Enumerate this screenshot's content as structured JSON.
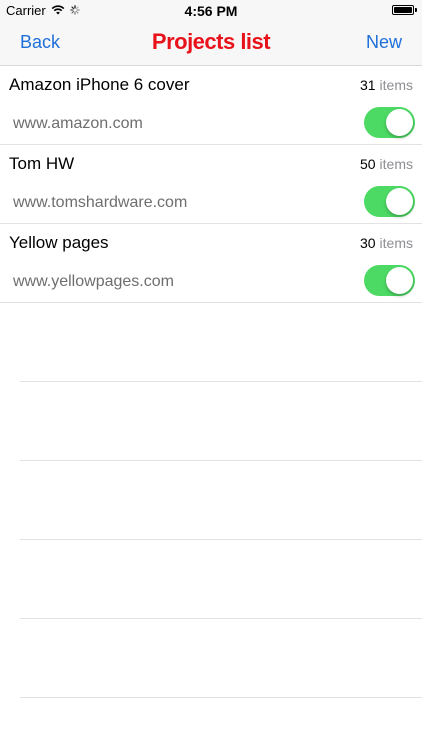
{
  "status_bar": {
    "carrier": "Carrier",
    "time": "4:56 PM"
  },
  "nav": {
    "back_label": "Back",
    "title": "Projects list",
    "new_label": "New",
    "title_color": "#e8121a",
    "accent_color": "#1e6fd9"
  },
  "projects": [
    {
      "name": "Amazon iPhone 6 cover",
      "count": "31",
      "unit": "items",
      "url": "www.amazon.com",
      "enabled": true
    },
    {
      "name": "Tom HW",
      "count": "50",
      "unit": "items",
      "url": "www.tomshardware.com",
      "enabled": true
    },
    {
      "name": "Yellow pages",
      "count": "30",
      "unit": "items",
      "url": "www.yellowpages.com",
      "enabled": true
    }
  ],
  "toggle_on_color": "#4cd964"
}
